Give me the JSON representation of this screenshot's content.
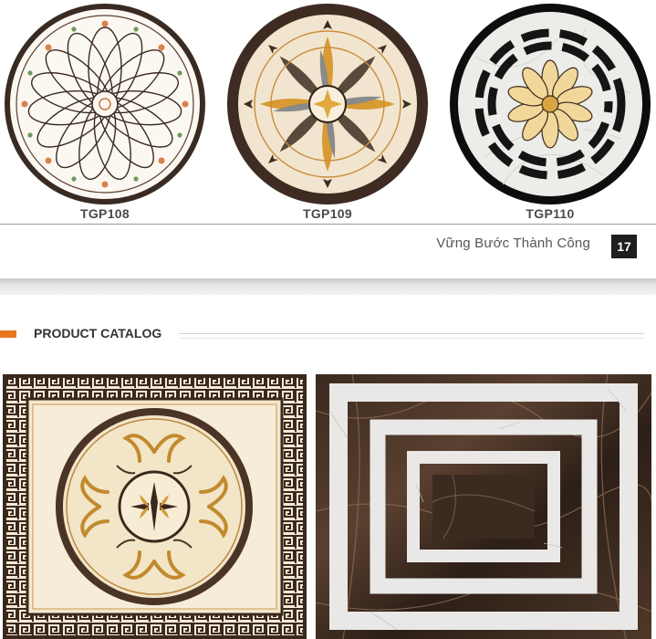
{
  "products": [
    {
      "code": "TGP108"
    },
    {
      "code": "TGP109"
    },
    {
      "code": "TGP110"
    }
  ],
  "footer": {
    "slogan": "Vững Bước Thành Công",
    "page_number": "17"
  },
  "section": {
    "title": "PRODUCT CATALOG"
  },
  "colors": {
    "accent": "#e8761f",
    "dark_marble": "#3a2a1f",
    "cream_marble": "#f3e6cc",
    "gold": "#d4a043"
  }
}
